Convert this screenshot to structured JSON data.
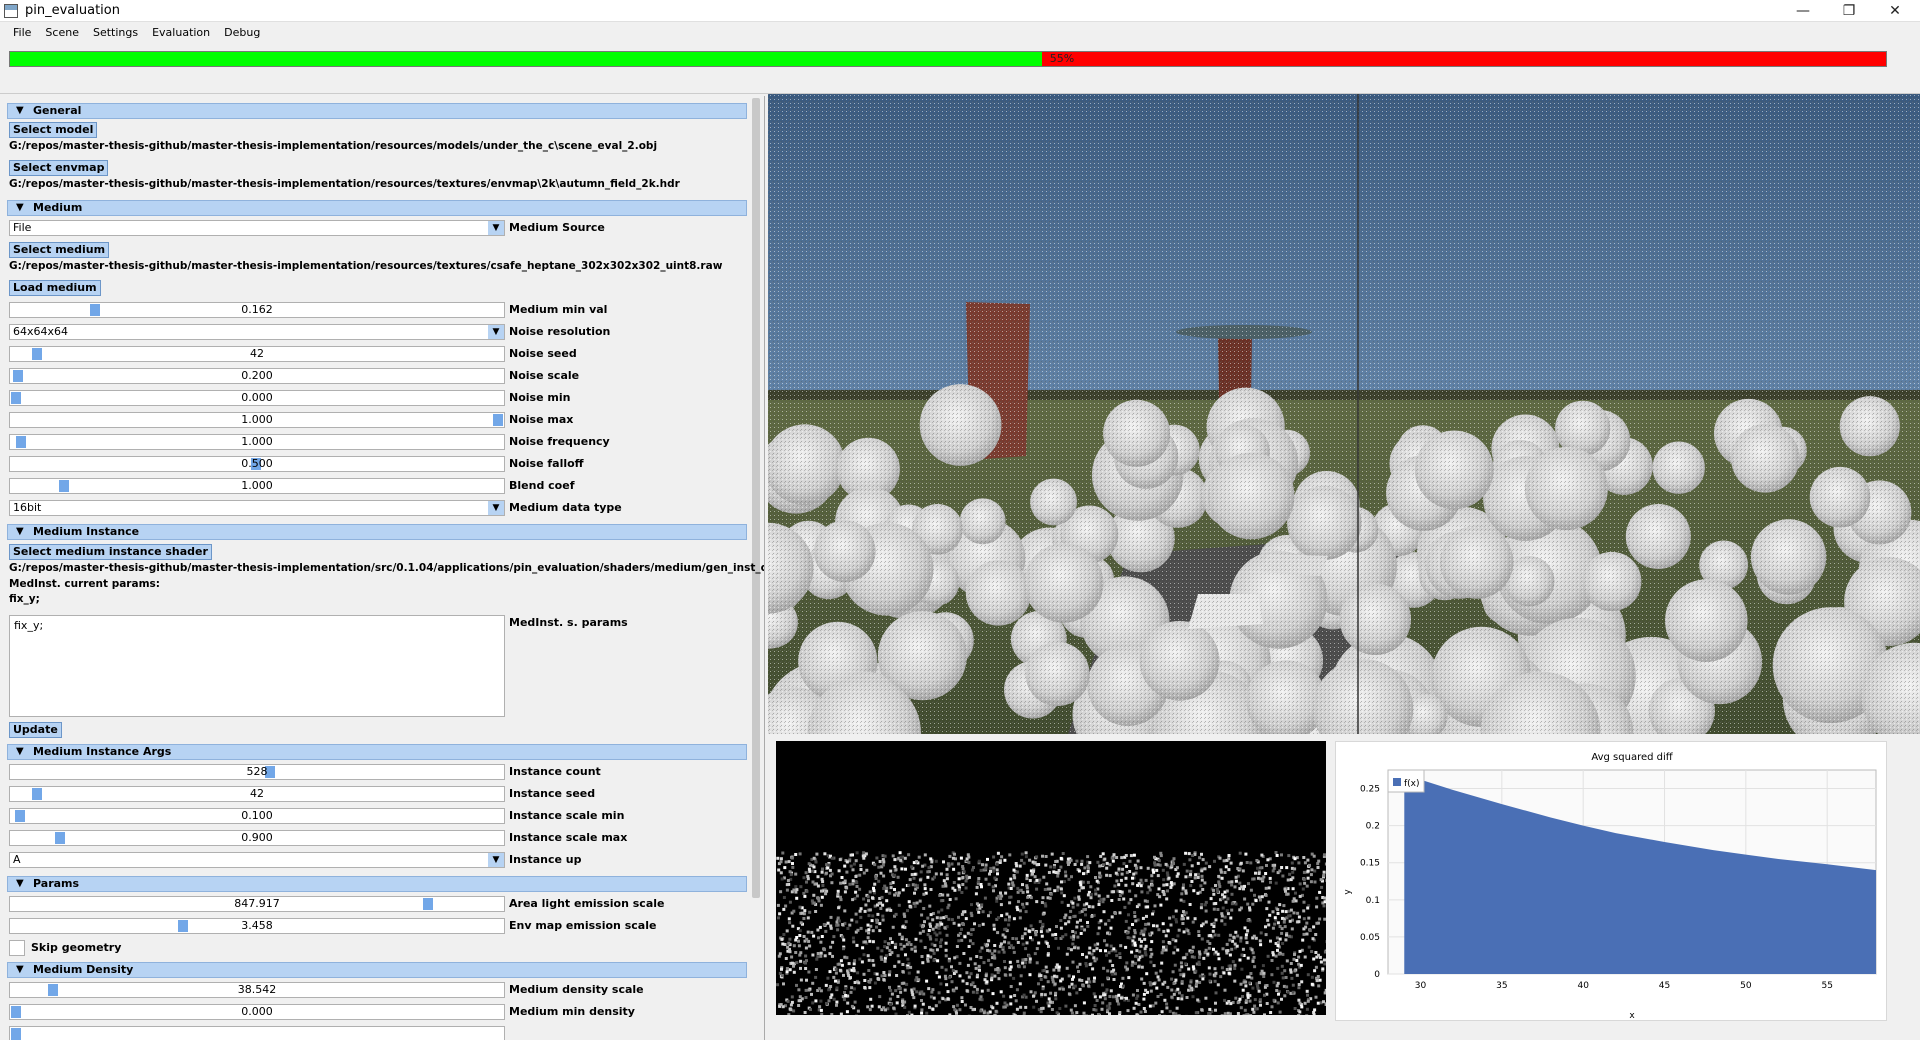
{
  "window": {
    "title": "pin_evaluation",
    "minimize": "—",
    "restore": "❐",
    "close": "✕"
  },
  "menu": [
    "File",
    "Scene",
    "Settings",
    "Evaluation",
    "Debug"
  ],
  "progress": {
    "value": 0.55,
    "label": "55%"
  },
  "general": {
    "header": "General",
    "select_model": "Select model",
    "model_path": "G:/repos/master-thesis-github/master-thesis-implementation/resources/models/under_the_c\\scene_eval_2.obj",
    "select_envmap": "Select envmap",
    "envmap_path": "G:/repos/master-thesis-github/master-thesis-implementation/resources/textures/envmap\\2k\\autumn_field_2k.hdr"
  },
  "medium": {
    "header": "Medium",
    "source_value": "File",
    "source_label": "Medium Source",
    "select_medium": "Select medium",
    "medium_path": "G:/repos/master-thesis-github/master-thesis-implementation/resources/textures/csafe_heptane_302x302x302_uint8.raw",
    "load_medium": "Load medium",
    "min_val": "0.162",
    "min_val_label": "Medium min val",
    "noise_res": "64x64x64",
    "noise_res_label": "Noise resolution",
    "noise_seed": "42",
    "noise_seed_label": "Noise seed",
    "noise_scale": "0.200",
    "noise_scale_label": "Noise scale",
    "noise_min": "0.000",
    "noise_min_label": "Noise min",
    "noise_max": "1.000",
    "noise_max_label": "Noise max",
    "noise_freq": "1.000",
    "noise_freq_label": "Noise frequency",
    "noise_falloff": "0.500",
    "noise_falloff_label": "Noise falloff",
    "blend_coef": "1.000",
    "blend_coef_label": "Blend coef",
    "data_type": "16bit",
    "data_type_label": "Medium data type"
  },
  "instance": {
    "header": "Medium Instance",
    "select_shader": "Select medium instance shader",
    "shader_path": "G:/repos/master-thesis-github/master-thesis-implementation/src/0.1.04/applications/pin_evaluation/shaders/medium/gen_inst_default.comp",
    "current_params_label": "MedInst. current params:",
    "current_params": "fix_y;",
    "params_text": "fix_y;",
    "params_label": "MedInst. s. params",
    "update": "Update"
  },
  "instance_args": {
    "header": "Medium Instance Args",
    "count": "528",
    "count_label": "Instance count",
    "seed": "42",
    "seed_label": "Instance seed",
    "scale_min": "0.100",
    "scale_min_label": "Instance scale min",
    "scale_max": "0.900",
    "scale_max_label": "Instance scale max",
    "up": "A",
    "up_label": "Instance up"
  },
  "params": {
    "header": "Params",
    "area_light": "847.917",
    "area_light_label": "Area light emission scale",
    "env_map": "3.458",
    "env_map_label": "Env map emission scale",
    "skip_geometry_label": "Skip geometry"
  },
  "density": {
    "header": "Medium Density",
    "scale": "38.542",
    "scale_label": "Medium density scale",
    "min": "0.000",
    "min_label": "Medium min density"
  },
  "colors": {
    "accent": "#b7d3f3",
    "grab": "#72a7e8",
    "progress_done": "#00ff00",
    "progress_rest": "#ff0000",
    "chart_fill": "#4a6fb5"
  },
  "chart_data": {
    "type": "area",
    "title": "Avg squared diff",
    "xlabel": "x",
    "ylabel": "y",
    "legend": "f(x)",
    "legend_position": "top-left",
    "xlim": [
      28,
      58
    ],
    "ylim": [
      0,
      0.275
    ],
    "xticks": [
      "30",
      "35",
      "40",
      "45",
      "50",
      "55"
    ],
    "yticks": [
      "0",
      "0.05",
      "0.1",
      "0.15",
      "0.2",
      "0.25"
    ],
    "x": [
      29,
      30,
      32,
      35,
      38,
      40,
      42,
      45,
      48,
      50,
      52,
      55,
      58
    ],
    "y": [
      0.272,
      0.262,
      0.248,
      0.229,
      0.211,
      0.2,
      0.19,
      0.178,
      0.167,
      0.161,
      0.155,
      0.148,
      0.14
    ]
  }
}
